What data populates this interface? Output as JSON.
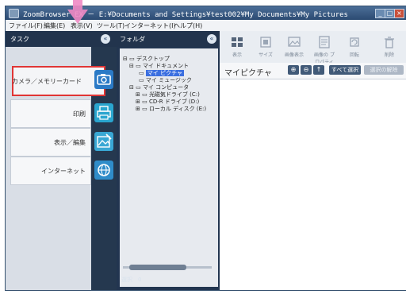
{
  "window": {
    "title": "ZoomBrowser EX － E:¥Documents and Settings¥test002¥My Documents¥My Pictures",
    "controls": {
      "minimize": "_",
      "maximize": "□",
      "close": "×"
    }
  },
  "menu": {
    "items": [
      "ファイル(F)",
      "編集(E)",
      "表示(V)",
      "ツール(T)",
      "インターネット(I)",
      "ヘルプ(H)"
    ]
  },
  "task_panel": {
    "title": "タスク",
    "collapse": "«",
    "buttons": [
      {
        "label": "カメラ／メモリーカード",
        "icon": "camera-icon",
        "color": "#2b7ac6"
      },
      {
        "label": "印刷",
        "icon": "printer-icon",
        "color": "#2aa5cf"
      },
      {
        "label": "表示／編集",
        "icon": "image-edit-icon",
        "color": "#39a7d4"
      },
      {
        "label": "インターネット",
        "icon": "globe-icon",
        "color": "#2f8cc9"
      }
    ]
  },
  "folder_panel": {
    "title": "フォルダ",
    "collapse": "«",
    "tree": [
      "デスクトップ",
      "マイ ドキュメント",
      "マイ ピクチャ",
      "マイ ミュージック",
      "マイ コンピュータ",
      "光磁気ドライブ (C:)",
      "CD-R ドライブ (D:)",
      "ローカル ディスク (E:)"
    ],
    "status": "選択　0"
  },
  "toolbar": {
    "tools": [
      {
        "label": "表示",
        "icon": "view-icon"
      },
      {
        "label": "サイズ",
        "icon": "size-icon"
      },
      {
        "label": "画像表示",
        "icon": "image-view-icon"
      },
      {
        "label": "画像の\nプロパティ",
        "icon": "properties-icon"
      },
      {
        "label": "回転",
        "icon": "rotate-icon"
      },
      {
        "label": "削除",
        "icon": "trash-icon"
      }
    ]
  },
  "view": {
    "folder_title": "マイピクチャ",
    "select_all": "すべて選択",
    "deselect": "選択の解除"
  },
  "colors": {
    "accent": "#e03535",
    "panel_dark": "#22344d",
    "annotation_arrow": "#f08ac4"
  }
}
